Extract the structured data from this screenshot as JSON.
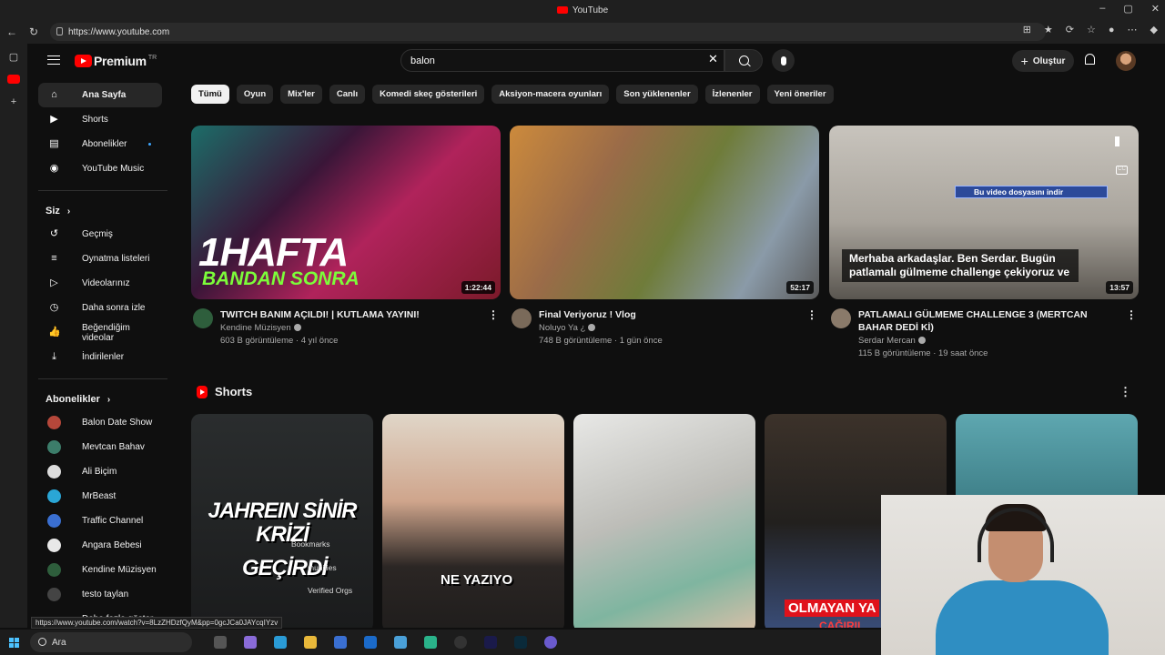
{
  "window": {
    "title": "YouTube",
    "controls": [
      "–",
      "▢",
      "✕"
    ]
  },
  "browser": {
    "url": "https://www.youtube.com",
    "status_url": "https://www.youtube.com/watch?v=8LzZHDzfQyM&pp=0gcJCa0JAYcqIYzv"
  },
  "masthead": {
    "logo_text": "Premium",
    "logo_region": "TR",
    "search_value": "balon",
    "create_label": "Oluştur"
  },
  "sidebar": {
    "main": [
      {
        "label": "Ana Sayfa",
        "icon": "home-icon",
        "glyph": "⌂"
      },
      {
        "label": "Shorts",
        "icon": "shorts-icon",
        "glyph": "▶"
      },
      {
        "label": "Abonelikler",
        "icon": "subscriptions-icon",
        "glyph": "▤"
      },
      {
        "label": "YouTube Music",
        "icon": "music-icon",
        "glyph": "◉"
      }
    ],
    "you_header": "Siz",
    "you": [
      {
        "label": "Geçmiş",
        "glyph": "↺"
      },
      {
        "label": "Oynatma listeleri",
        "glyph": "≡"
      },
      {
        "label": "Videolarınız",
        "glyph": "▷"
      },
      {
        "label": "Daha sonra izle",
        "glyph": "◷"
      },
      {
        "label": "Beğendiğim videolar",
        "glyph": "👍"
      },
      {
        "label": "İndirilenler",
        "glyph": "⤓"
      }
    ],
    "subs_header": "Abonelikler",
    "subs": [
      {
        "label": "Balon Date Show",
        "color": "#b5473a"
      },
      {
        "label": "Mevtcan Bahav",
        "color": "#3c7d6a"
      },
      {
        "label": "Ali Biçim",
        "color": "#dcdcdc"
      },
      {
        "label": "MrBeast",
        "color": "#2aa6d6"
      },
      {
        "label": "Traffic Channel",
        "color": "#3a6fd1"
      },
      {
        "label": "Angara Bebesi",
        "color": "#e8e8e8"
      },
      {
        "label": "Kendine Müzisyen",
        "color": "#2e5e3c"
      },
      {
        "label": "testo taylan",
        "color": "#444444"
      }
    ],
    "more_label": "Daha fazla göster"
  },
  "chips": [
    "Tümü",
    "Oyun",
    "Mix'ler",
    "Canlı",
    "Komedi skeç gösterileri",
    "Aksiyon-macera oyunları",
    "Son yüklenenler",
    "İzlenenler",
    "Yeni öneriler"
  ],
  "videos": [
    {
      "title": "TWITCH BANIM AÇILDI! | KUTLAMA YAYINI!",
      "channel": "Kendine Müzisyen",
      "stats": "603 B görüntüleme · 4 yıl önce",
      "duration": "1:22:44",
      "thumb_text_1": "1HAFTA",
      "thumb_text_2": "BANDAN SONRA"
    },
    {
      "title": "Final Veriyoruz ! Vlog",
      "channel": "Noluyo Ya ¿",
      "stats": "748 B görüntüleme · 1 gün önce",
      "duration": "52:17"
    },
    {
      "title": "PATLAMALI GÜLMEME CHALLENGE 3 (MERTCAN BAHAR DEDİ Kİ)",
      "channel": "Serdar Mercan",
      "stats": "115 B görüntüleme · 19 saat önce",
      "duration": "13:57",
      "download_badge": "Bu video dosyasını indir",
      "caption": "Merhaba arkadaşlar. Ben Serdar. Bugün patlamalı gülmeme challenge çekiyoruz ve"
    }
  ],
  "shorts": {
    "header": "Shorts",
    "s1_text_1": "JAHREIN SİNİR KRİZİ",
    "s1_text_2": "GEÇİRDİ",
    "s1_menu": [
      "Bookmarks",
      "munities",
      "Verified Orgs"
    ],
    "s2_text": "NE YAZIYO",
    "s4_text_1": "OLMAYAN YA",
    "s4_text_2": "ÇAĞIRIL"
  },
  "taskbar": {
    "search_label": "Ara"
  }
}
